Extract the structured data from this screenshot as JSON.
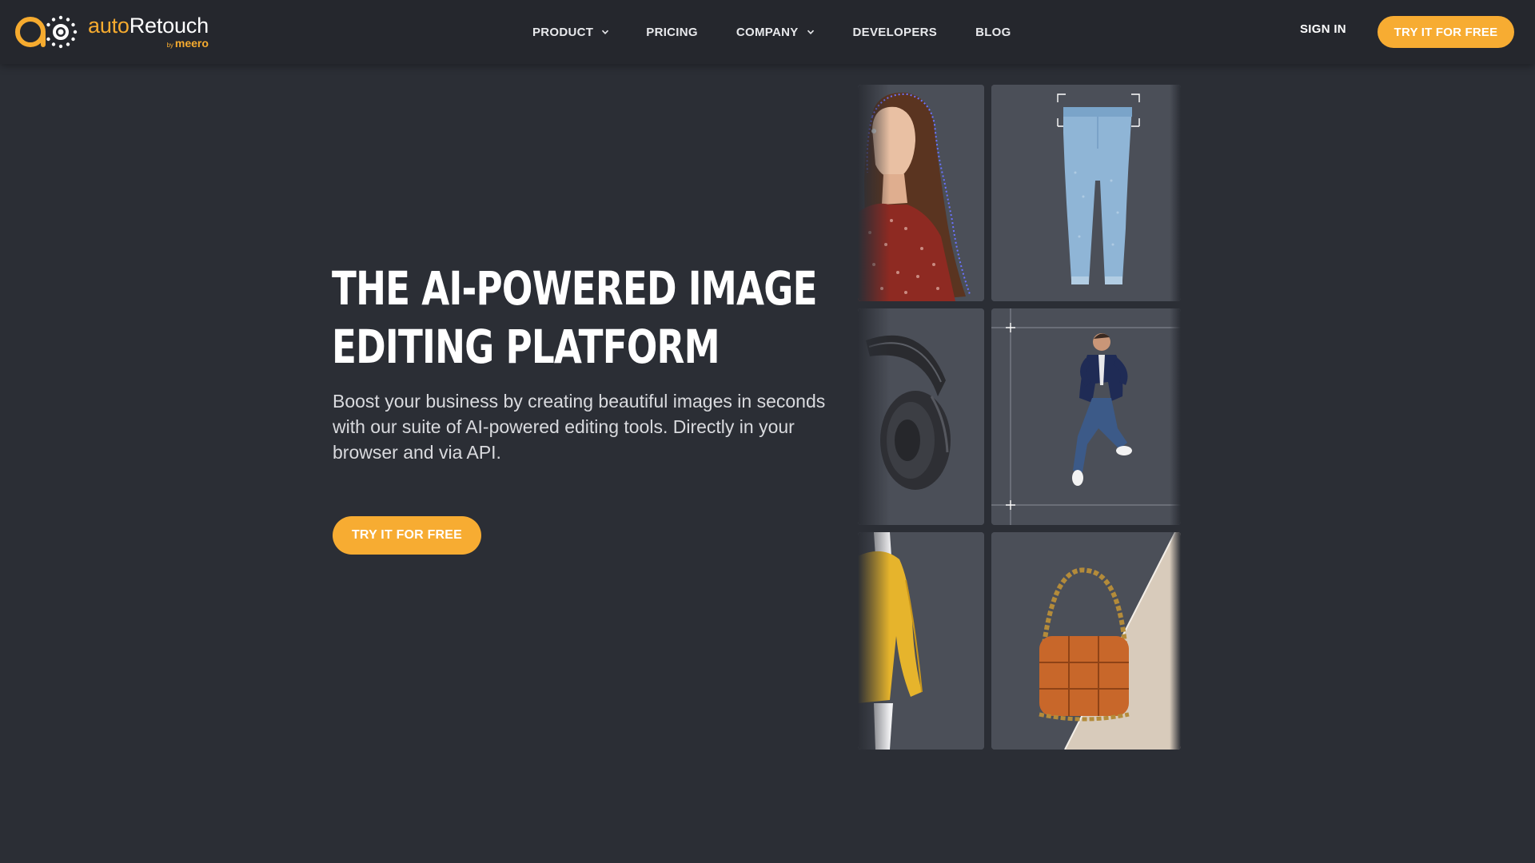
{
  "brand": {
    "name_part1": "auto",
    "name_part2": "Retouch",
    "by_prefix": "by",
    "by_name": "meero",
    "accent_color": "#f6ab2f"
  },
  "nav": {
    "items": [
      {
        "label": "PRODUCT",
        "has_dropdown": true
      },
      {
        "label": "PRICING",
        "has_dropdown": false
      },
      {
        "label": "COMPANY",
        "has_dropdown": true
      },
      {
        "label": "DEVELOPERS",
        "has_dropdown": false
      },
      {
        "label": "BLOG",
        "has_dropdown": false
      }
    ],
    "sign_in": "SIGN IN",
    "cta": "TRY IT FOR FREE"
  },
  "hero": {
    "title_line1": "THE AI-POWERED IMAGE",
    "title_line2": "EDITING PLATFORM",
    "subtitle": "Boost your business by creating beautiful images in seconds with our suite of AI-powered editing tools. Directly in your browser and via API.",
    "cta": "TRY IT FOR FREE"
  },
  "gallery": {
    "tiles": [
      {
        "subject": "woman-portrait"
      },
      {
        "subject": "jeans"
      },
      {
        "subject": "headphones"
      },
      {
        "subject": "jumping-man"
      },
      {
        "subject": "yellow-blouse"
      },
      {
        "subject": "orange-handbag"
      }
    ]
  },
  "colors": {
    "background": "#2b2e35",
    "nav_background": "#25272d",
    "tile_background": "#4a4e57",
    "button": "#f7ac32"
  }
}
